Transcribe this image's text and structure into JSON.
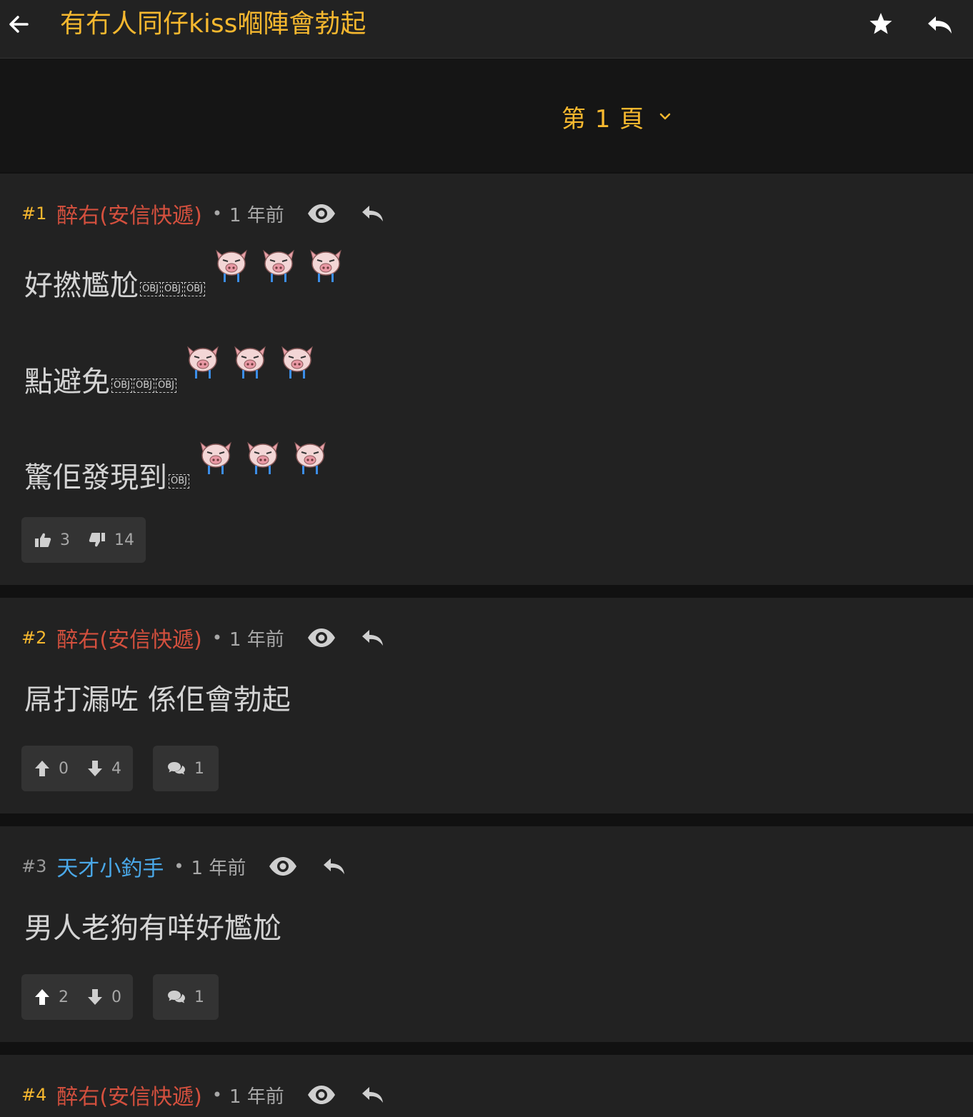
{
  "header": {
    "title": "有冇人同仔kiss嗰陣會勃起"
  },
  "pagination": {
    "label": "第 1 頁"
  },
  "posts": [
    {
      "number": "#1",
      "author": "醉右(安信快遞)",
      "separator": "•",
      "time": "1 年前",
      "lines": [
        {
          "text": "好撚尷尬",
          "objs": [
            "OBJ",
            "OBJ",
            "OBJ"
          ],
          "emoji_count": 3
        },
        {
          "text": "點避免",
          "objs": [
            "OBJ",
            "OBJ",
            "OBJ"
          ],
          "emoji_count": 3
        },
        {
          "text": "驚佢發現到",
          "objs": [
            "OBJ"
          ],
          "emoji_count": 3
        }
      ],
      "likes": "3",
      "dislikes": "14",
      "emoji": "crying-pig-face"
    },
    {
      "number": "#2",
      "author": "醉右(安信快遞)",
      "separator": "•",
      "time": "1 年前",
      "text": "屌打漏咗 係佢會勃起",
      "upvotes": "0",
      "downvotes": "4",
      "comments": "1"
    },
    {
      "number": "#3",
      "author": "天才小釣手",
      "separator": "•",
      "time": "1 年前",
      "text": "男人老狗有咩好尷尬",
      "upvotes": "2",
      "downvotes": "0",
      "comments": "1"
    },
    {
      "number": "#4",
      "author": "醉右(安信快遞)",
      "separator": "•",
      "time": "1 年前"
    }
  ],
  "colors": {
    "accent": "#f6b82f",
    "author_op": "#d4503e",
    "author_other": "#4aa8e8",
    "background": "#111111",
    "card": "#222222",
    "button": "#333333"
  }
}
